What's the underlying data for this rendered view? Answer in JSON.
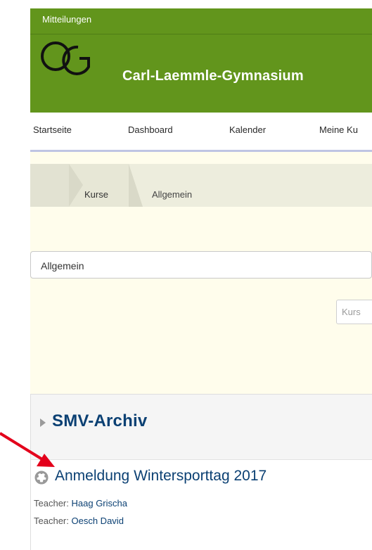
{
  "header": {
    "messages_label": "Mitteilungen",
    "site_title": "Carl-Laemmle-Gymnasium",
    "brand_color": "#62951c"
  },
  "nav": {
    "items": [
      {
        "label": "Startseite"
      },
      {
        "label": "Dashboard"
      },
      {
        "label": "Kalender"
      },
      {
        "label": "Meine Ku"
      }
    ]
  },
  "breadcrumb": {
    "items": [
      {
        "label": "Kurse"
      },
      {
        "label": "Allgemein"
      }
    ]
  },
  "category": {
    "selected": "Allgemein"
  },
  "search": {
    "placeholder": "Kurs"
  },
  "course_section": {
    "title": "SMV-Archiv",
    "course": {
      "name": "Anmeldung Wintersporttag 2017",
      "teachers": [
        {
          "label": "Teacher:",
          "name": "Haag Grischa"
        },
        {
          "label": "Teacher:",
          "name": "Oesch David"
        }
      ]
    }
  },
  "annotation": {
    "color": "#e3001b",
    "icon": "arrow-icon"
  },
  "colors": {
    "link": "#0b4073",
    "content_bg": "#fffdec",
    "breadcrumb_bg": "#ededdd",
    "nav_underline": "#bfc5e3"
  }
}
